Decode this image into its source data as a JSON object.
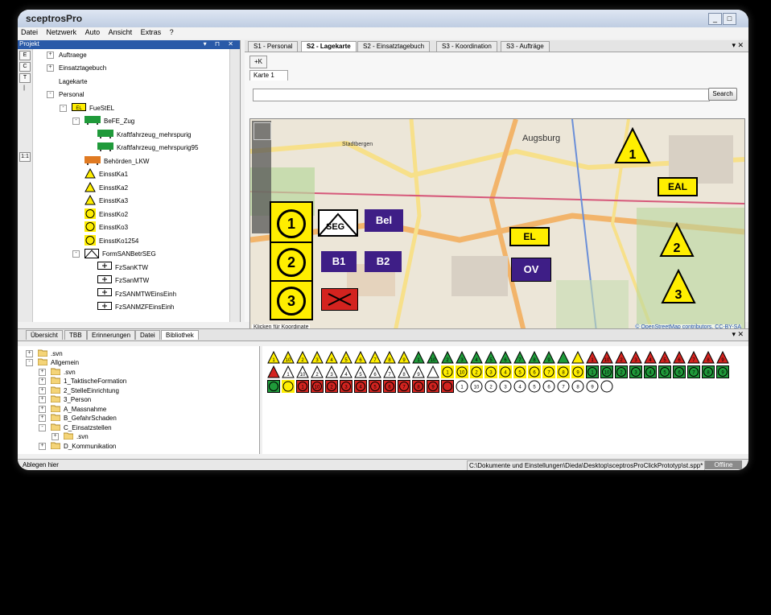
{
  "window": {
    "title": "sceptrosPro"
  },
  "menu": [
    "Datei",
    "Netzwerk",
    "Auto",
    "Ansicht",
    "Extras",
    "?"
  ],
  "project_panel": {
    "title": "Projekt",
    "tools": [
      "E",
      "C",
      "T"
    ],
    "scale": "1:1",
    "tree": [
      {
        "label": "Auftraege",
        "indent": 0,
        "expander": "+"
      },
      {
        "label": "Einsatztagebuch",
        "indent": 0,
        "expander": "+"
      },
      {
        "label": "Lagekarte",
        "indent": 0,
        "expander": ""
      },
      {
        "label": "Personal",
        "indent": 0,
        "expander": "-"
      },
      {
        "label": "FueStEL",
        "indent": 1,
        "expander": "-",
        "icon": "EL"
      },
      {
        "label": "BeFE_Zug",
        "indent": 2,
        "expander": "-",
        "icon": "green-vehicle"
      },
      {
        "label": "Kraftfahrzeug_mehrspurig",
        "indent": 3,
        "expander": "",
        "icon": "green-vehicle"
      },
      {
        "label": "Kraftfahrzeug_mehrspurig95",
        "indent": 3,
        "expander": "",
        "icon": "green-vehicle"
      },
      {
        "label": "Behörden_LKW",
        "indent": 2,
        "expander": "",
        "icon": "orange-truck"
      },
      {
        "label": "EinsstKa1",
        "indent": 2,
        "expander": "",
        "icon": "yellow-triangle"
      },
      {
        "label": "EinsstKa2",
        "indent": 2,
        "expander": "",
        "icon": "yellow-triangle"
      },
      {
        "label": "EinsstKa3",
        "indent": 2,
        "expander": "",
        "icon": "yellow-triangle"
      },
      {
        "label": "EinsstKo2",
        "indent": 2,
        "expander": "",
        "icon": "yellow-circle"
      },
      {
        "label": "EinsstKo3",
        "indent": 2,
        "expander": "",
        "icon": "yellow-circle"
      },
      {
        "label": "EinsstKo1254",
        "indent": 2,
        "expander": "",
        "icon": "yellow-circle"
      },
      {
        "label": "FormSANBetrSEG",
        "indent": 2,
        "expander": "-",
        "icon": "seg"
      },
      {
        "label": "FzSanKTW",
        "indent": 3,
        "expander": "",
        "icon": "ambulance"
      },
      {
        "label": "FzSanMTW",
        "indent": 3,
        "expander": "",
        "icon": "ambulance"
      },
      {
        "label": "FzSANMTWEinsEinh",
        "indent": 3,
        "expander": "",
        "icon": "ambulance"
      },
      {
        "label": "FzSANMZFEinsEinh",
        "indent": 3,
        "expander": "",
        "icon": "ambulance"
      }
    ]
  },
  "tabs": [
    "S1 - Personal",
    "S2 - Lagekarte",
    "S2 - Einsatztagebuch",
    "S3 - Koordination",
    "S3 - Aufträge"
  ],
  "active_tab": "S2 - Lagekarte",
  "map_panel": {
    "toolbar_button": "+K",
    "sheet_tab": "Karte 1",
    "search_placeholder": "",
    "search_button": "Search",
    "city_label": "Augsburg",
    "district_label": "Stadtbergen",
    "coord_hint": "Klicken für Koordinate",
    "copyright": "© OpenStreetMap contributors, CC-BY-SA",
    "markers": {
      "tri1": "1",
      "tri2": "2",
      "tri3": "3",
      "eal": "EAL",
      "el": "EL",
      "ov": "OV",
      "stack1": "1",
      "stack2": "2",
      "stack3": "3",
      "seg": "SEG",
      "bel": "Bel",
      "b1": "B1",
      "b2": "B2"
    }
  },
  "bottom_tabs": [
    "Übersicht",
    "TBB",
    "Erinnerungen",
    "Datei",
    "Bibliothek"
  ],
  "active_bottom_tab": "Bibliothek",
  "library_tree": [
    {
      "label": ".svn",
      "indent": 0,
      "expander": "+"
    },
    {
      "label": "Allgemein",
      "indent": 0,
      "expander": "-"
    },
    {
      "label": ".svn",
      "indent": 1,
      "expander": "+"
    },
    {
      "label": "1_TaktischeFormation",
      "indent": 1,
      "expander": "+"
    },
    {
      "label": "2_StelleEinrichtung",
      "indent": 1,
      "expander": "+"
    },
    {
      "label": "3_Person",
      "indent": 1,
      "expander": "+"
    },
    {
      "label": "A_Massnahme",
      "indent": 1,
      "expander": "+"
    },
    {
      "label": "B_GefahrSchaden",
      "indent": 1,
      "expander": "+"
    },
    {
      "label": "C_Einsatzstellen",
      "indent": 1,
      "expander": "-"
    },
    {
      "label": ".svn",
      "indent": 2,
      "expander": "+"
    },
    {
      "label": "D_Kommunikation",
      "indent": 1,
      "expander": "+"
    }
  ],
  "library_symbols": {
    "row1_yellow_tri": [
      "1",
      "10",
      "2",
      "3",
      "4",
      "5",
      "6",
      "7",
      "8",
      "9"
    ],
    "row1_green_tri": [
      "1",
      "10",
      "2",
      "3",
      "4",
      "5",
      "6",
      "7",
      "8",
      "9",
      ""
    ],
    "row1_yellow_tri2": [
      ""
    ],
    "row1_red_tri": [
      "1",
      "10",
      "2",
      "3",
      "4",
      "5"
    ],
    "row2_red_tri": [
      "6",
      "7",
      "8",
      "9",
      ""
    ],
    "row2_white_tri": [
      "1",
      "10",
      "2",
      "3",
      "4",
      "5",
      "6",
      "7",
      "8",
      "9",
      ""
    ],
    "row2_yellow_circ": [
      "1",
      "10",
      "2",
      "3",
      "4",
      "5",
      "6",
      "7",
      "8",
      "9"
    ],
    "row3_green_sq": [
      "1",
      "10",
      "2",
      "3",
      "4",
      "5",
      "6",
      "7",
      "8",
      "9",
      ""
    ],
    "row3_yellow_circ": [
      ""
    ],
    "row3_red_sq": [
      "1",
      "10",
      "2",
      "3",
      "4",
      "5",
      "6",
      "7",
      "8",
      "9",
      ""
    ],
    "row3_white_circ": [
      "1"
    ],
    "row4_white_circ": [
      "10",
      "2",
      "3",
      "4",
      "5",
      "6",
      "7",
      "8",
      "9",
      ""
    ]
  },
  "status": {
    "left": "Ablegen hier",
    "path": "C:\\Dokumente und Einstellungen\\Dieda\\Desktop\\sceptrosProClickPrototyp\\st.spp*",
    "mode": "Offline"
  },
  "colors": {
    "yellow": "#ffee00",
    "green": "#1f9a3a",
    "red": "#d3231f",
    "purple": "#3e1e86",
    "title_blue": "#2a5aa8"
  }
}
